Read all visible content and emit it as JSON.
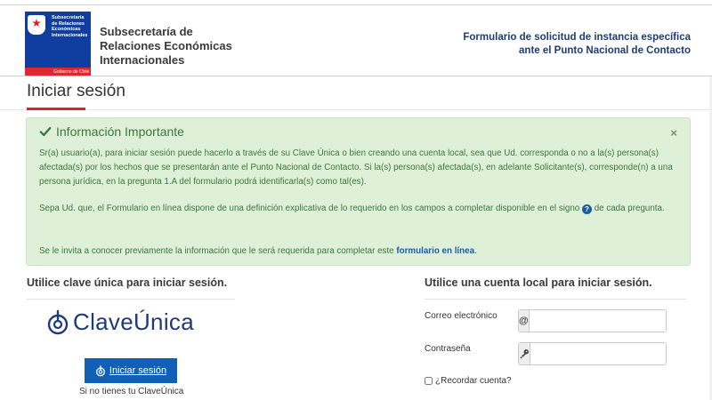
{
  "header": {
    "logo_text": "Subsecretaría de Relaciones Económicas Internacionales",
    "logo_gov": "Gobierno de Chile",
    "org_name_lines": [
      "Subsecretaría de",
      "Relaciones Económicas",
      "Internacionales"
    ],
    "form_title_lines": [
      "Formulario de solicitud de instancia específica",
      "ante el Punto Nacional de Contacto"
    ]
  },
  "page": {
    "title": "Iniciar sesión"
  },
  "alert": {
    "heading": "Información Importante",
    "close": "×",
    "p1": "Sr(a) usuario(a), para iniciar sesión puede hacerlo a través de su Clave Única o bien creando una cuenta local, sea que Ud. corresponda o no a la(s) persona(s) afectada(s) por los hechos que se presentarán ante el Punto Nacional de Contacto. Si la(s) persona(s) afectada(s), en adelante Solicitante(s), corresponde(n) a una persona jurídica, en la pregunta 1.A del formulario podrá identificarla(s) como tal(es).",
    "p2_before": "Sepa Ud. que, el Formulario en línea dispone de una definición explicativa de lo requerido en los campos a completar disponible en el signo",
    "p2_icon": "?",
    "p2_after": "de cada pregunta.",
    "p3_before": "Se le invita a conocer previamente la información que le será requerida para completar este",
    "p3_link": "formulario en línea",
    "p3_after": "."
  },
  "left": {
    "heading": "Utilice clave única para iniciar sesión.",
    "brand_a": "Clave",
    "brand_b": "Única",
    "login_button": "Iniciar sesión",
    "no_account": "Si no tienes tu ClaveÚnica"
  },
  "right": {
    "heading": "Utilice una cuenta local para iniciar sesión.",
    "email_label": "Correo electrónico",
    "email_addon": "@",
    "email_value": "",
    "password_label": "Contraseña",
    "password_value": "",
    "remember_label": "¿Recordar cuenta?"
  },
  "colors": {
    "accent_blue": "#1060b8",
    "alert_green": "#3c763d",
    "alert_bg": "#dff0d8",
    "title_red": "#d2233a",
    "navy": "#1d3c78"
  }
}
